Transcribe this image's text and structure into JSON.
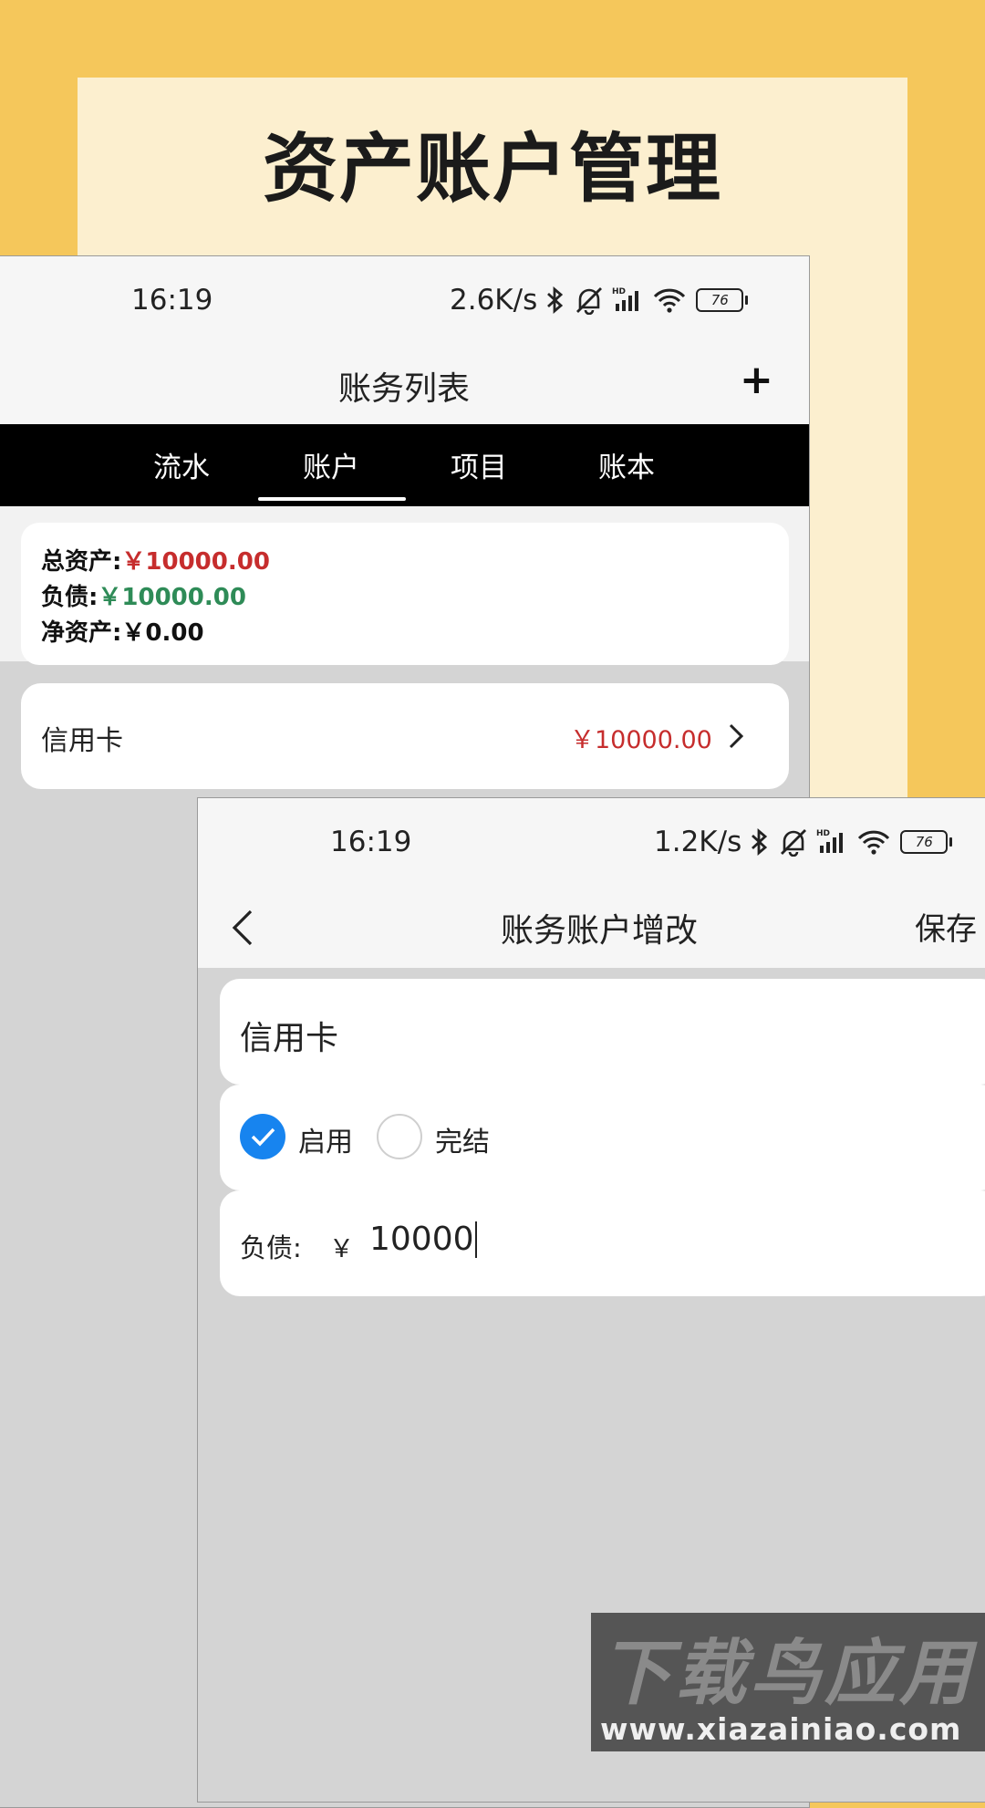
{
  "headline": "资产账户管理",
  "colors": {
    "background": "#F5C75B",
    "panel": "#FCEFCF",
    "accent_blue": "#1784ef",
    "asset_red": "#c62d2d",
    "debt_green": "#2e8b57"
  },
  "list_screen": {
    "status": {
      "time": "16:19",
      "speed": "2.6K/s",
      "battery": "76",
      "icons": [
        "bluetooth-icon",
        "mute-icon",
        "signal-icon",
        "wifi-icon",
        "battery-icon"
      ]
    },
    "title": "账务列表",
    "add_label": "+",
    "tabs": [
      {
        "label": "流水"
      },
      {
        "label": "账户"
      },
      {
        "label": "项目"
      },
      {
        "label": "账本"
      }
    ],
    "active_tab": "账户",
    "summary": {
      "total_assets_label": "总资产:",
      "total_assets_value": "￥10000.00",
      "liabilities_label": "负债:",
      "liabilities_value": "￥10000.00",
      "net_assets_label": "净资产:",
      "net_assets_value": "￥0.00"
    },
    "accounts": [
      {
        "name": "信用卡",
        "amount": "￥10000.00"
      }
    ]
  },
  "edit_screen": {
    "status": {
      "time": "16:19",
      "speed": "1.2K/s",
      "battery": "76"
    },
    "title": "账务账户增改",
    "save_label": "保存",
    "account_name": "信用卡",
    "status_options": [
      {
        "label": "启用",
        "selected": true
      },
      {
        "label": "完结",
        "selected": false
      }
    ],
    "debt_label": "负债:",
    "currency_symbol": "￥",
    "debt_value": "10000"
  },
  "watermark": {
    "logo_text": "下载鸟应用",
    "url": "www.xiazainiao.com"
  }
}
